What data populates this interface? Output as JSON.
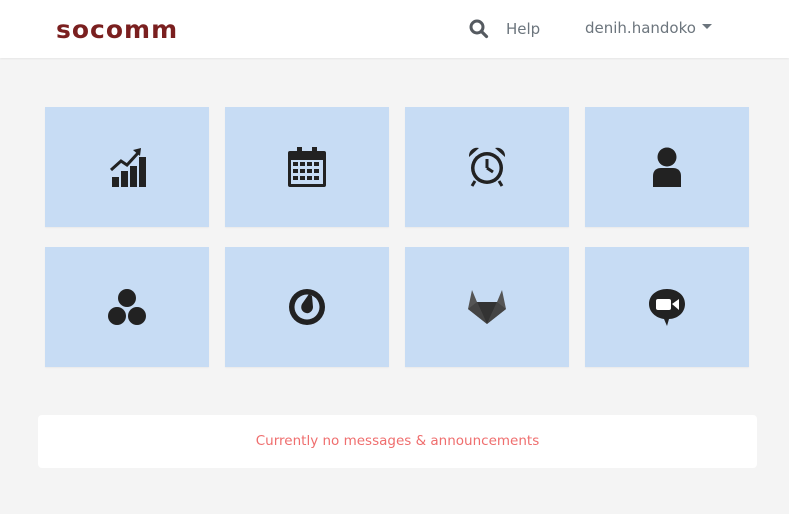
{
  "navbar": {
    "brand": "socomm",
    "search_icon": "search-icon",
    "help_label": "Help",
    "user_label": "denih.handoko"
  },
  "tiles": [
    {
      "icon": "chart-growth-icon"
    },
    {
      "icon": "calendar-icon"
    },
    {
      "icon": "alarm-clock-icon"
    },
    {
      "icon": "user-icon"
    },
    {
      "icon": "circles-icon"
    },
    {
      "icon": "mattermost-icon"
    },
    {
      "icon": "gitlab-icon"
    },
    {
      "icon": "video-chat-icon"
    }
  ],
  "messages": {
    "text": "Currently no messages & announcements"
  },
  "colors": {
    "brand": "#7a1f1f",
    "tile_background": "#c7dcf4",
    "icon": "#222222",
    "message_text": "#ef6e6e",
    "page_background": "#f4f4f4"
  }
}
